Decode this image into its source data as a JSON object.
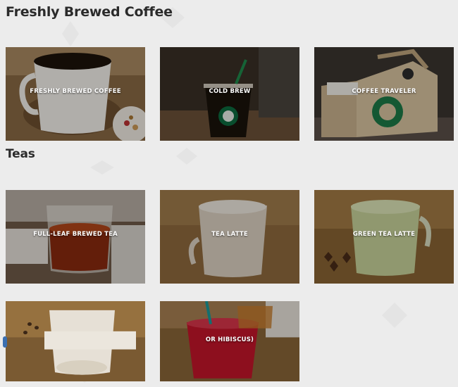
{
  "sections": [
    {
      "title": "Freshly Brewed Coffee"
    },
    {
      "title": "Teas"
    }
  ],
  "coffee_tiles": [
    {
      "label": "FRESHLY BREWED COFFEE"
    },
    {
      "label": "COLD BREW"
    },
    {
      "label": "COFFEE TRAVELER"
    }
  ],
  "tea_tiles": [
    {
      "label": "FULL-LEAF BREWED TEA"
    },
    {
      "label": "TEA LATTE"
    },
    {
      "label": "GREEN TEA LATTE"
    },
    {
      "label": ""
    },
    {
      "label": "OR HIBISCUS)"
    }
  ],
  "colors": {
    "background": "#ececec",
    "heading": "#2b2b2b",
    "label": "#ffffff"
  }
}
